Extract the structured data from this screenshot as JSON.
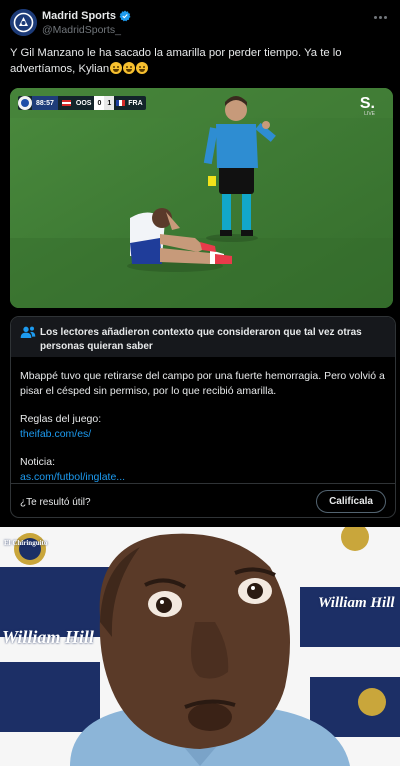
{
  "tweet": {
    "display_name": "Madrid Sports",
    "handle": "@MadridSports_",
    "text": "Y Gil Manzano le ha sacado la amarilla por perder tiempo. Ya te lo advertíamos, Kylian",
    "emojis": [
      "upside-down-face",
      "upside-down-face",
      "upside-down-face"
    ],
    "verified": true
  },
  "media": {
    "scoreboard": {
      "time": "88:57",
      "home_team": "OOS",
      "home_score": "0",
      "away_score": "1",
      "away_team": "FRA"
    },
    "broadcaster": "S.",
    "broadcaster_sub": "LIVE"
  },
  "community_note": {
    "title": "Los lectores añadieron contexto que consideraron que tal vez otras personas quieran saber",
    "body": "Mbappé tuvo que retirarse del campo por una fuerte hemorragia. Pero volvió a pisar el césped sin permiso, por lo que recibió amarilla.",
    "rules_label": "Reglas del juego:",
    "rules_link": "theifab.com/es/",
    "news_label": "Noticia:",
    "news_link": "as.com/futbol/inglate...",
    "helpful_question": "¿Te resultó útil?",
    "rate_button": "Califícala"
  },
  "meme": {
    "sponsor_banner": "William Hill",
    "badge_text": "El Chiringuito"
  },
  "colors": {
    "tweet_bg": "#000000",
    "link_blue": "#1d9bf0",
    "verified_blue": "#1d9bf0",
    "pitch_green": "#3f7a35",
    "note_header_bg": "#16181c"
  }
}
